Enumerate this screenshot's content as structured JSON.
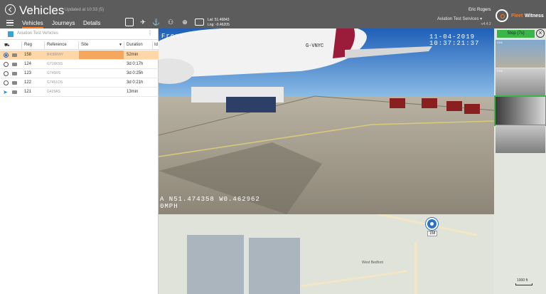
{
  "header": {
    "title": "Vehicles",
    "updated": "Updated at 10:33 (5)",
    "tabs": [
      {
        "label": "Vehicles",
        "active": true
      },
      {
        "label": "Journeys",
        "active": false
      },
      {
        "label": "Details",
        "active": false
      }
    ],
    "lat": "Lat: 51.46843",
    "lng": "Lng: -0.46205",
    "user": "Eric Rogers",
    "account": "Aviation Test Services",
    "version": "v4.4.2",
    "brand_fleet": "Fleet",
    "brand_witness": "Witness",
    "accent": "#ff7a1a"
  },
  "panel": {
    "filter_name": "Aviation Test Vehicles",
    "columns": [
      "Reg",
      "Reference",
      "Site",
      "Duration",
      "Id"
    ],
    "rows": [
      {
        "reg": "158",
        "ref": "B438RWY",
        "site": "",
        "duration": "52min",
        "selected": true,
        "status": "radio-on"
      },
      {
        "reg": "124",
        "ref": "G716KSS",
        "site": "",
        "duration": "3d 0:17h",
        "selected": false,
        "status": "radio"
      },
      {
        "reg": "123",
        "ref": "G745RS",
        "site": "",
        "duration": "3d 0:25h",
        "selected": false,
        "status": "radio"
      },
      {
        "reg": "122",
        "ref": "G7451OS",
        "site": "",
        "duration": "3d 0:21h",
        "selected": false,
        "status": "radio"
      },
      {
        "reg": "121",
        "ref": "G429AS",
        "site": "",
        "duration": "13min",
        "selected": false,
        "status": "arrow"
      }
    ]
  },
  "video": {
    "camera_label": "Front",
    "date": "11-04-2019",
    "time": "10:37:21:37",
    "coords": "A N51.474358 W0.462962",
    "speed": "0MPH",
    "aircraft_reg": "G-VNYC"
  },
  "thumbnails": {
    "stop_label": "Stop (7s)",
    "labels": [
      "CH1",
      "CH2",
      "",
      ""
    ]
  },
  "map": {
    "marker_label": "158",
    "scale_label": "1000 ft",
    "place_label": "West Bedfont"
  }
}
